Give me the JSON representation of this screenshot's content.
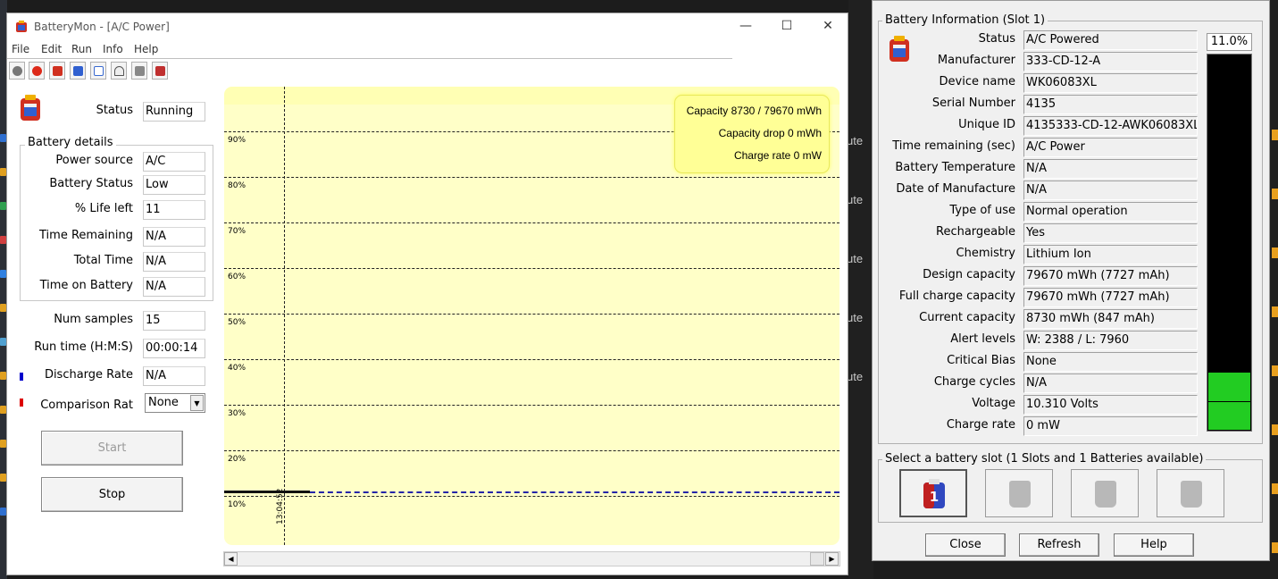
{
  "main_window": {
    "title": "BatteryMon - [A/C Power]",
    "controls": {
      "minimize": "—",
      "maximize": "☐",
      "close": "✕"
    },
    "menu": [
      "File",
      "Edit",
      "Run",
      "Info",
      "Help"
    ],
    "toolbar_icons": [
      "stop-sign-icon",
      "stop-icon",
      "battery-icon",
      "battery-info-icon",
      "checklist-icon",
      "gauge-icon",
      "hand-icon",
      "battery-exchange-icon"
    ],
    "status": {
      "label": "Status",
      "value": "Running"
    },
    "battery_details": {
      "title": "Battery details",
      "rows": [
        {
          "label": "Power source",
          "value": "A/C"
        },
        {
          "label": "Battery Status",
          "value": "Low"
        },
        {
          "label": "% Life left",
          "value": "11"
        },
        {
          "label": "Time Remaining",
          "value": "N/A"
        },
        {
          "label": "Total Time",
          "value": "N/A"
        },
        {
          "label": "Time on Battery",
          "value": "N/A"
        }
      ]
    },
    "stats": [
      {
        "label": "Num samples",
        "value": "15"
      },
      {
        "label": "Run time (H:M:S)",
        "value": "00:00:14"
      },
      {
        "label": "Discharge Rate",
        "value": "N/A",
        "marker_color": "#0000cc"
      }
    ],
    "comparison": {
      "label": "Comparison Rat",
      "value": "None",
      "marker_color": "#dd0000"
    },
    "buttons": {
      "start": "Start",
      "stop": "Stop"
    }
  },
  "chart_data": {
    "type": "line",
    "info_box": [
      "Capacity 8730 / 79670 mWh",
      "Capacity drop 0 mWh",
      "Charge rate 0 mW"
    ],
    "y_ticks": [
      "90%",
      "80%",
      "70%",
      "60%",
      "50%",
      "40%",
      "30%",
      "20%",
      "10%"
    ],
    "x_ticks": [
      "13:04:52"
    ],
    "series": [
      {
        "values": [
          11,
          11
        ],
        "color": "#111111",
        "style": "solid"
      },
      {
        "values": [
          11,
          11
        ],
        "color": "#2424a8",
        "style": "dashed"
      }
    ],
    "ylim": [
      0,
      100
    ],
    "grid": true
  },
  "info_window": {
    "group_title": "Battery Information (Slot 1)",
    "percent": "11.0%",
    "fill_fraction": 0.11,
    "rows": [
      {
        "label": "Status",
        "value": "A/C Powered"
      },
      {
        "label": "Manufacturer",
        "value": "333-CD-12-A"
      },
      {
        "label": "Device name",
        "value": "WK06083XL"
      },
      {
        "label": "Serial Number",
        "value": "4135"
      },
      {
        "label": "Unique ID",
        "value": "4135333-CD-12-AWK06083XL"
      },
      {
        "label": "Time remaining (sec)",
        "value": "A/C Power"
      },
      {
        "label": "Battery Temperature",
        "value": "N/A"
      },
      {
        "label": "Date of Manufacture",
        "value": "N/A"
      },
      {
        "label": "Type of use",
        "value": "Normal operation"
      },
      {
        "label": "Rechargeable",
        "value": "Yes"
      },
      {
        "label": "Chemistry",
        "value": "Lithium Ion"
      },
      {
        "label": "Design capacity",
        "value": "79670 mWh (7727 mAh)"
      },
      {
        "label": "Full charge capacity",
        "value": "79670 mWh (7727 mAh)"
      },
      {
        "label": "Current capacity",
        "value": "8730 mWh (847 mAh)"
      },
      {
        "label": "Alert levels",
        "value": "W: 2388 / L: 7960"
      },
      {
        "label": "Critical Bias",
        "value": "None"
      },
      {
        "label": "Charge cycles",
        "value": "N/A"
      },
      {
        "label": "Voltage",
        "value": "10.310 Volts"
      },
      {
        "label": "Charge rate",
        "value": "0 mW"
      }
    ],
    "slot_title": "Select a battery slot (1 Slots and 1 Batteries available)",
    "slot_active_label": "1",
    "buttons": {
      "close": "Close",
      "refresh": "Refresh",
      "help": "Help"
    }
  },
  "background": {
    "peek_text": [
      "ute",
      "ute",
      "ute",
      "ute",
      "ute"
    ]
  }
}
